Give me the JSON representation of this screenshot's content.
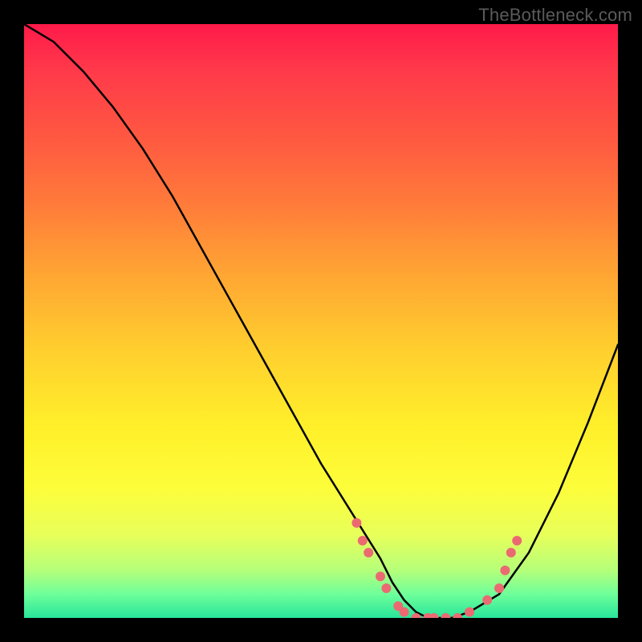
{
  "watermark": "TheBottleneck.com",
  "chart_data": {
    "type": "line",
    "title": "",
    "xlabel": "",
    "ylabel": "",
    "xlim": [
      0,
      100
    ],
    "ylim": [
      0,
      100
    ],
    "series": [
      {
        "name": "bottleneck-curve",
        "x": [
          0,
          5,
          10,
          15,
          20,
          25,
          30,
          35,
          40,
          45,
          50,
          55,
          60,
          62,
          64,
          66,
          68,
          70,
          72,
          75,
          80,
          85,
          90,
          95,
          100
        ],
        "y": [
          100,
          97,
          92,
          86,
          79,
          71,
          62,
          53,
          44,
          35,
          26,
          18,
          10,
          6,
          3,
          1,
          0,
          0,
          0,
          1,
          4,
          11,
          21,
          33,
          46
        ]
      }
    ],
    "markers": {
      "name": "highlight-dots",
      "color": "#eb6a72",
      "points": [
        {
          "x": 56,
          "y": 16
        },
        {
          "x": 57,
          "y": 13
        },
        {
          "x": 58,
          "y": 11
        },
        {
          "x": 60,
          "y": 7
        },
        {
          "x": 61,
          "y": 5
        },
        {
          "x": 63,
          "y": 2
        },
        {
          "x": 64,
          "y": 1
        },
        {
          "x": 66,
          "y": 0
        },
        {
          "x": 68,
          "y": 0
        },
        {
          "x": 69,
          "y": 0
        },
        {
          "x": 71,
          "y": 0
        },
        {
          "x": 73,
          "y": 0
        },
        {
          "x": 75,
          "y": 1
        },
        {
          "x": 78,
          "y": 3
        },
        {
          "x": 80,
          "y": 5
        },
        {
          "x": 81,
          "y": 8
        },
        {
          "x": 82,
          "y": 11
        },
        {
          "x": 83,
          "y": 13
        }
      ]
    }
  }
}
